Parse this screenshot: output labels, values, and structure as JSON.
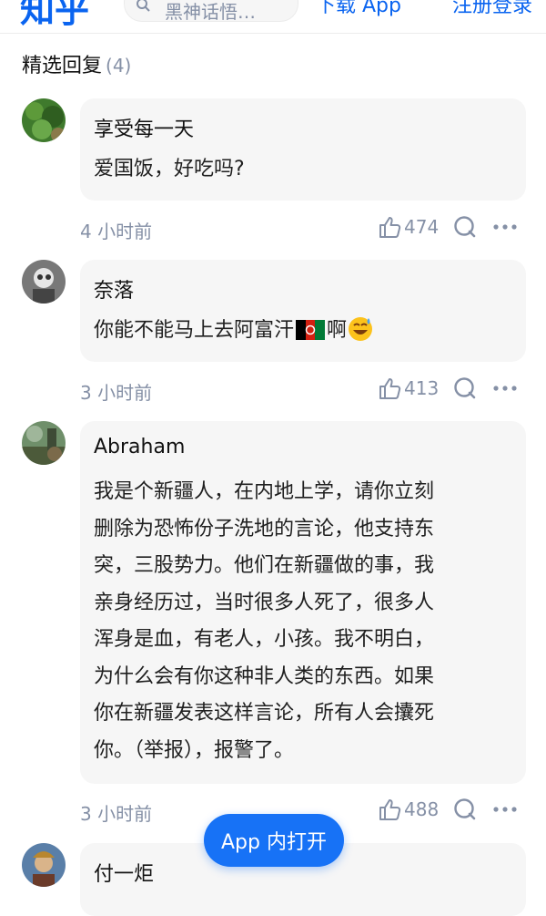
{
  "header": {
    "logo": "知乎",
    "search_placeholder": "黑神话悟…",
    "download": "下载 App",
    "register": "注册登录"
  },
  "section": {
    "title": "精选回复",
    "count": "(4)"
  },
  "comments": [
    {
      "author": "享受每一天",
      "content": "爱国饭，好吃吗?",
      "time": "4 小时前",
      "likes": "474"
    },
    {
      "author": "奈落",
      "content_before": "你能不能马上去阿富汗",
      "content_after": "啊",
      "time": "3 小时前",
      "likes": "413"
    },
    {
      "author": "Abraham",
      "lines": [
        "我是个新疆人，在内地上学，请你立刻",
        "删除为恐怖份子洗地的言论，他支持东",
        "突，三股势力。他们在新疆做的事，我",
        "亲身经历过，当时很多人死了，很多人",
        "浑身是血，有老人，小孩。我不明白，",
        "为什么会有你这种非人类的东西。如果",
        "你在新疆发表这样言论，所有人会攮死",
        "你。（举报），报警了。"
      ],
      "time": "3 小时前",
      "likes": "488"
    },
    {
      "author": "付一炬"
    }
  ],
  "open_app": "App 内打开",
  "colors": {
    "brand": "#0a64f0",
    "button": "#1772f6",
    "bubble": "#f6f6f6",
    "meta": "#8590a6"
  },
  "icons": [
    "search-icon",
    "like-icon",
    "reply-icon",
    "more-icon",
    "afghanistan-flag-icon",
    "sweat-smile-emoji-icon"
  ]
}
